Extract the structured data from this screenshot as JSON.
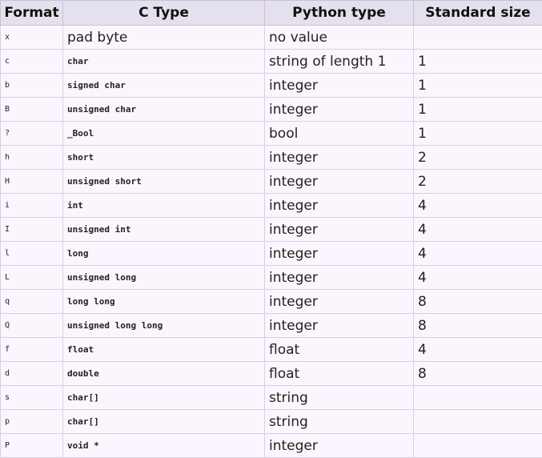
{
  "headers": [
    "Format",
    "C Type",
    "Python type",
    "Standard size"
  ],
  "rows": [
    {
      "format": "x",
      "ctype": "pad byte",
      "python": "no value",
      "size": ""
    },
    {
      "format": "c",
      "ctype": "char",
      "python": "string of length 1",
      "size": "1"
    },
    {
      "format": "b",
      "ctype": "signed char",
      "python": "integer",
      "size": "1"
    },
    {
      "format": "B",
      "ctype": "unsigned char",
      "python": "integer",
      "size": "1"
    },
    {
      "format": "?",
      "ctype": "_Bool",
      "python": "bool",
      "size": "1"
    },
    {
      "format": "h",
      "ctype": "short",
      "python": "integer",
      "size": "2"
    },
    {
      "format": "H",
      "ctype": "unsigned short",
      "python": "integer",
      "size": "2"
    },
    {
      "format": "i",
      "ctype": "int",
      "python": "integer",
      "size": "4"
    },
    {
      "format": "I",
      "ctype": "unsigned int",
      "python": "integer",
      "size": "4"
    },
    {
      "format": "l",
      "ctype": "long",
      "python": "integer",
      "size": "4"
    },
    {
      "format": "L",
      "ctype": "unsigned long",
      "python": "integer",
      "size": "4"
    },
    {
      "format": "q",
      "ctype": "long long",
      "python": "integer",
      "size": "8"
    },
    {
      "format": "Q",
      "ctype": "unsigned long long",
      "python": "integer",
      "size": "8"
    },
    {
      "format": "f",
      "ctype": "float",
      "python": "float",
      "size": "4"
    },
    {
      "format": "d",
      "ctype": "double",
      "python": "float",
      "size": "8"
    },
    {
      "format": "s",
      "ctype": "char[]",
      "python": "string",
      "size": ""
    },
    {
      "format": "p",
      "ctype": "char[]",
      "python": "string",
      "size": ""
    },
    {
      "format": "P",
      "ctype": "void *",
      "python": "integer",
      "size": ""
    }
  ]
}
